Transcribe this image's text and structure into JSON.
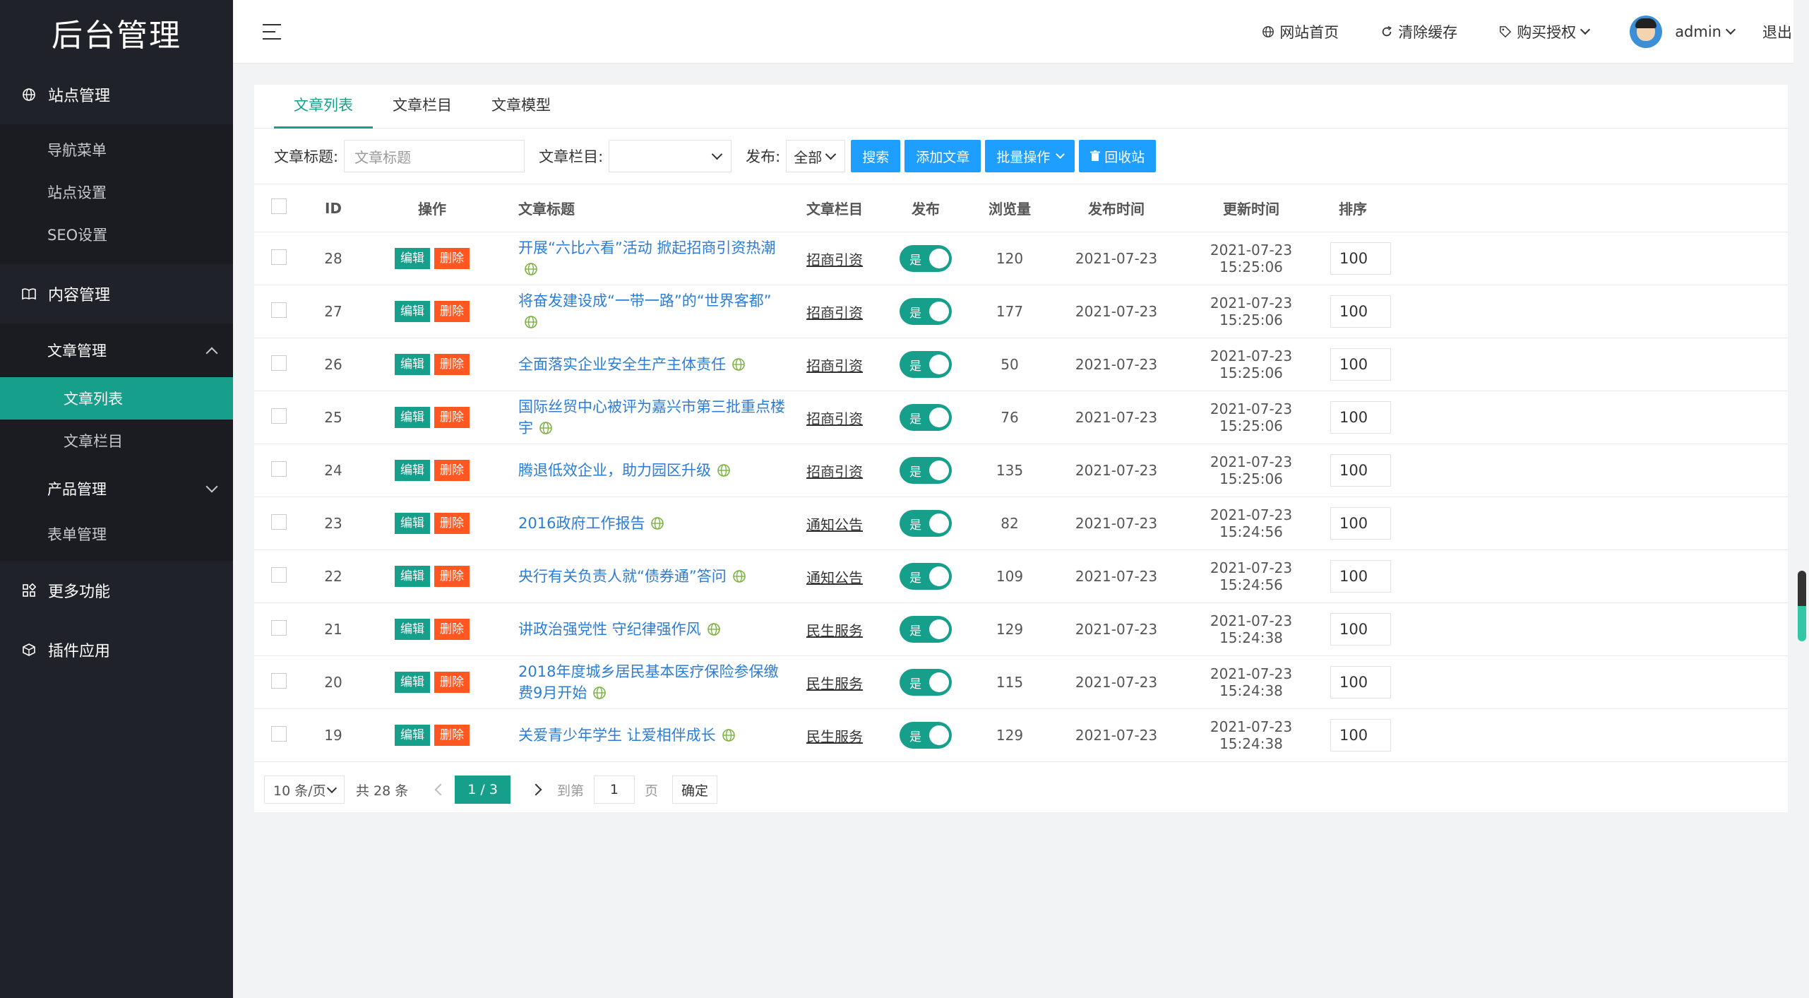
{
  "sidebar": {
    "logo": "后台管理",
    "groups": {
      "site": "站点管理",
      "content": "内容管理",
      "more": "更多功能",
      "plugins": "插件应用"
    },
    "site_items": [
      "导航菜单",
      "站点设置",
      "SEO设置"
    ],
    "article_mgmt": "文章管理",
    "article_items": [
      "文章列表",
      "文章栏目"
    ],
    "product_mgmt": "产品管理",
    "form_mgmt": "表单管理"
  },
  "header": {
    "links": {
      "home": "网站首页",
      "clear_cache": "清除缓存",
      "buy": "购买授权",
      "user": "admin",
      "logout": "退出"
    }
  },
  "tabs": [
    "文章列表",
    "文章栏目",
    "文章模型"
  ],
  "toolbar": {
    "title_label": "文章标题:",
    "title_placeholder": "文章标题",
    "column_label": "文章栏目:",
    "publish_label": "发布:",
    "publish_value": "全部",
    "search_btn": "搜索",
    "add_btn": "添加文章",
    "batch_btn": "批量操作",
    "recycle_btn": "回收站"
  },
  "table": {
    "headers": {
      "id": "ID",
      "op": "操作",
      "title": "文章标题",
      "column": "文章栏目",
      "publish": "发布",
      "views": "浏览量",
      "pub_time": "发布时间",
      "upd_time": "更新时间",
      "sort": "排序"
    },
    "edit_label": "编辑",
    "delete_label": "删除",
    "switch_label": "是",
    "rows": [
      {
        "id": "28",
        "title": "开展“六比六看”活动 掀起招商引资热潮",
        "column": "招商引资",
        "views": "120",
        "pub": "2021-07-23",
        "upd": "2021-07-23 15:25:06",
        "sort": "100"
      },
      {
        "id": "27",
        "title": "将奋发建设成“一带一路”的“世界客都”",
        "column": "招商引资",
        "views": "177",
        "pub": "2021-07-23",
        "upd": "2021-07-23 15:25:06",
        "sort": "100"
      },
      {
        "id": "26",
        "title": "全面落实企业安全生产主体责任",
        "column": "招商引资",
        "views": "50",
        "pub": "2021-07-23",
        "upd": "2021-07-23 15:25:06",
        "sort": "100"
      },
      {
        "id": "25",
        "title": "国际丝贸中心被评为嘉兴市第三批重点楼宇",
        "column": "招商引资",
        "views": "76",
        "pub": "2021-07-23",
        "upd": "2021-07-23 15:25:06",
        "sort": "100"
      },
      {
        "id": "24",
        "title": "腾退低效企业，助力园区升级",
        "column": "招商引资",
        "views": "135",
        "pub": "2021-07-23",
        "upd": "2021-07-23 15:25:06",
        "sort": "100"
      },
      {
        "id": "23",
        "title": "2016政府工作报告",
        "column": "通知公告",
        "views": "82",
        "pub": "2021-07-23",
        "upd": "2021-07-23 15:24:56",
        "sort": "100"
      },
      {
        "id": "22",
        "title": "央行有关负责人就“债券通”答问",
        "column": "通知公告",
        "views": "109",
        "pub": "2021-07-23",
        "upd": "2021-07-23 15:24:56",
        "sort": "100"
      },
      {
        "id": "21",
        "title": "讲政治强党性 守纪律强作风",
        "column": "民生服务",
        "views": "129",
        "pub": "2021-07-23",
        "upd": "2021-07-23 15:24:38",
        "sort": "100"
      },
      {
        "id": "20",
        "title": "2018年度城乡居民基本医疗保险参保缴费9月开始",
        "column": "民生服务",
        "views": "115",
        "pub": "2021-07-23",
        "upd": "2021-07-23 15:24:38",
        "sort": "100"
      },
      {
        "id": "19",
        "title": "关爱青少年学生 让爱相伴成长",
        "column": "民生服务",
        "views": "129",
        "pub": "2021-07-23",
        "upd": "2021-07-23 15:24:38",
        "sort": "100"
      }
    ]
  },
  "pager": {
    "per_page": "10 条/页",
    "total": "共 28 条",
    "current": "1 / 3",
    "goto_label": "到第",
    "goto_value": "1",
    "page_unit": "页",
    "confirm": "确定"
  },
  "colors": {
    "accent": "#16a08c",
    "primary_btn": "#1e9fff",
    "danger": "#ff5722",
    "sidebar_bg": "#20222a"
  }
}
